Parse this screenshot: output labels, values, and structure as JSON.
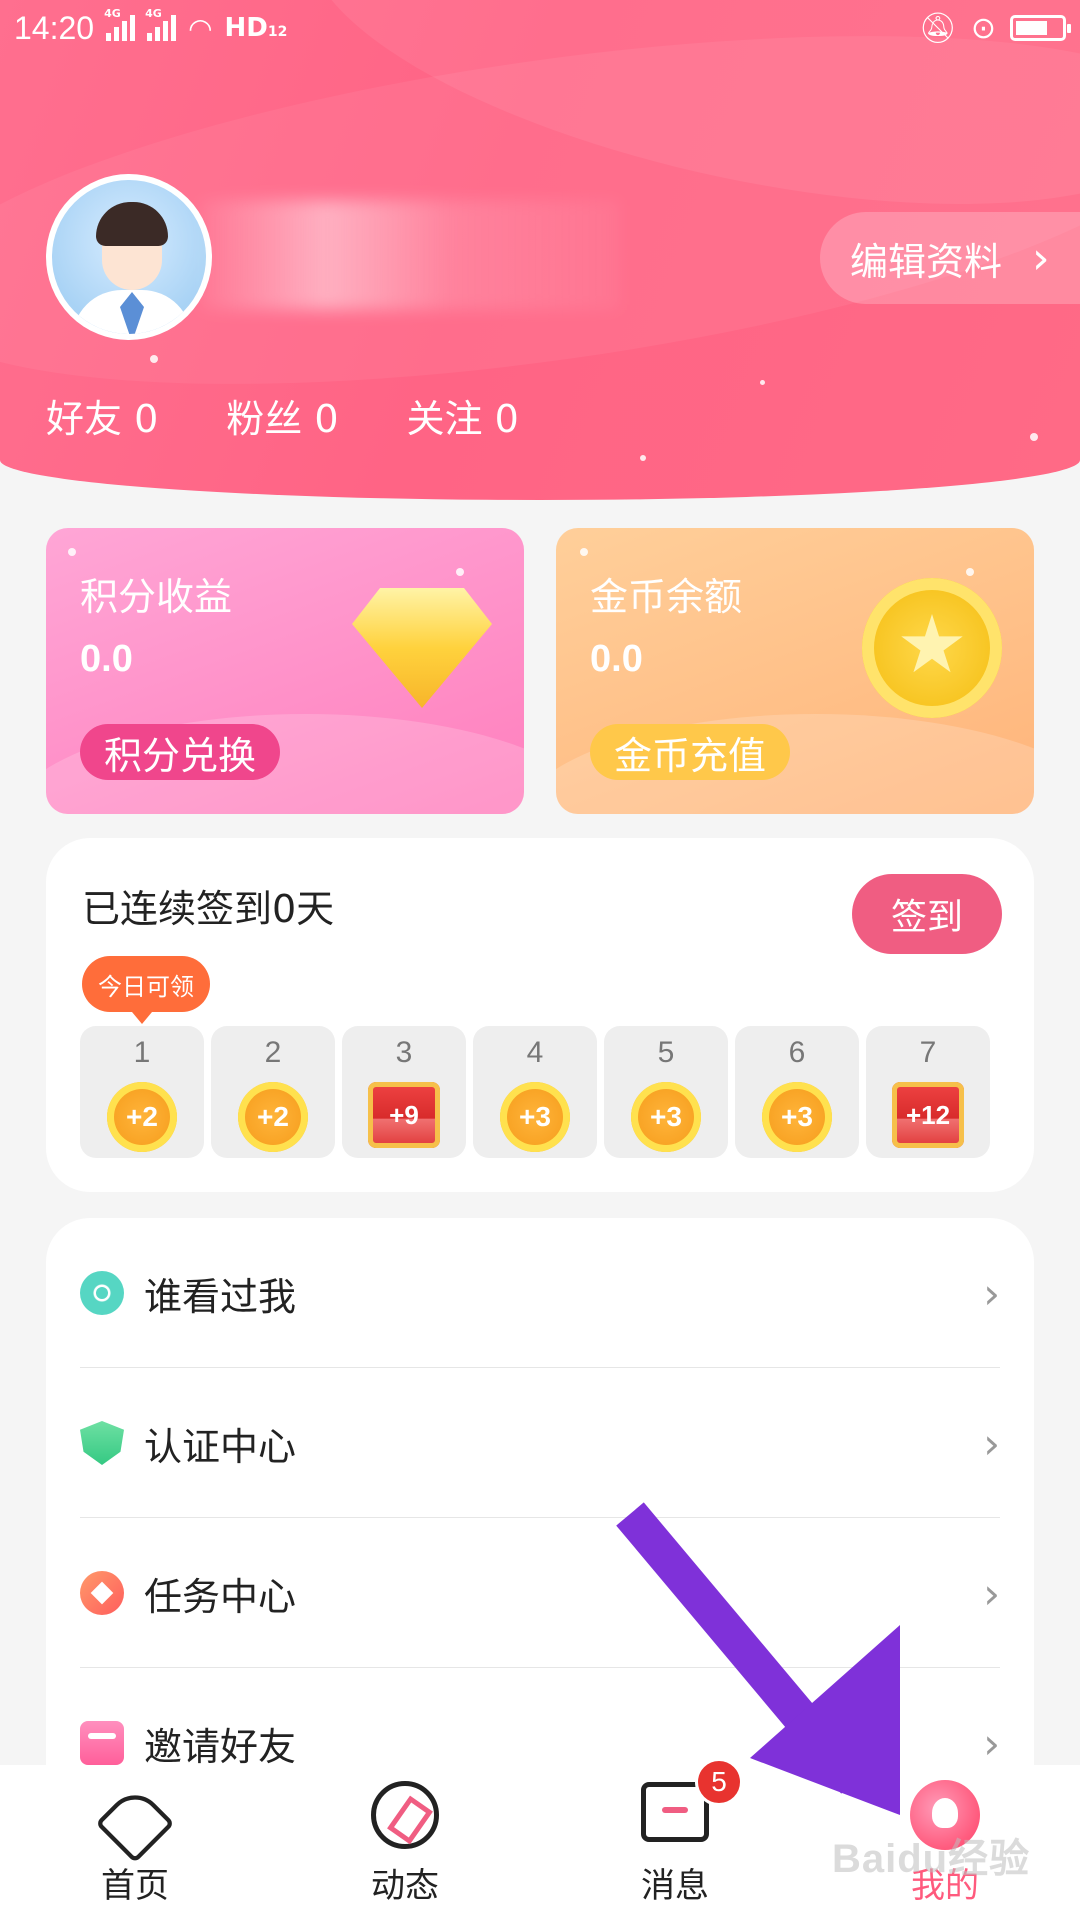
{
  "status_bar": {
    "time": "14:20",
    "network_labels": [
      "4G",
      "4G"
    ],
    "hd_label": "HD",
    "hd_sub": "12"
  },
  "profile": {
    "edit_label": "编辑资料",
    "stats": [
      {
        "label": "好友 0"
      },
      {
        "label": "粉丝 0"
      },
      {
        "label": "关注 0"
      }
    ]
  },
  "cards": {
    "points": {
      "title": "积分收益",
      "value": "0.0",
      "button": "积分兑换"
    },
    "gold": {
      "title": "金币余额",
      "value": "0.0",
      "button": "金币充值"
    }
  },
  "signin": {
    "title": "已连续签到0天",
    "button": "签到",
    "today_tag": "今日可领",
    "days": [
      {
        "day": "1",
        "reward": "+2",
        "kind": "coin"
      },
      {
        "day": "2",
        "reward": "+2",
        "kind": "coin"
      },
      {
        "day": "3",
        "reward": "+9",
        "kind": "chest"
      },
      {
        "day": "4",
        "reward": "+3",
        "kind": "coin"
      },
      {
        "day": "5",
        "reward": "+3",
        "kind": "coin"
      },
      {
        "day": "6",
        "reward": "+3",
        "kind": "coin"
      },
      {
        "day": "7",
        "reward": "+12",
        "kind": "chest"
      }
    ]
  },
  "menu": {
    "items": [
      {
        "label": "谁看过我",
        "icon": "eye-icon"
      },
      {
        "label": "认证中心",
        "icon": "shield-icon"
      },
      {
        "label": "任务中心",
        "icon": "task-icon"
      },
      {
        "label": "邀请好友",
        "icon": "envelope-icon"
      }
    ]
  },
  "bottom_nav": {
    "items": [
      {
        "label": "首页",
        "icon": "heart-icon"
      },
      {
        "label": "动态",
        "icon": "compass-icon"
      },
      {
        "label": "消息",
        "icon": "chat-icon",
        "badge": "5"
      },
      {
        "label": "我的",
        "icon": "profile-icon",
        "active": true
      }
    ]
  },
  "watermark": "Baidu经验",
  "colors": {
    "accent": "#ff5a7d",
    "header": "#ff6485",
    "signin_button": "#f05d82",
    "annotation_arrow": "#7f31d9"
  }
}
